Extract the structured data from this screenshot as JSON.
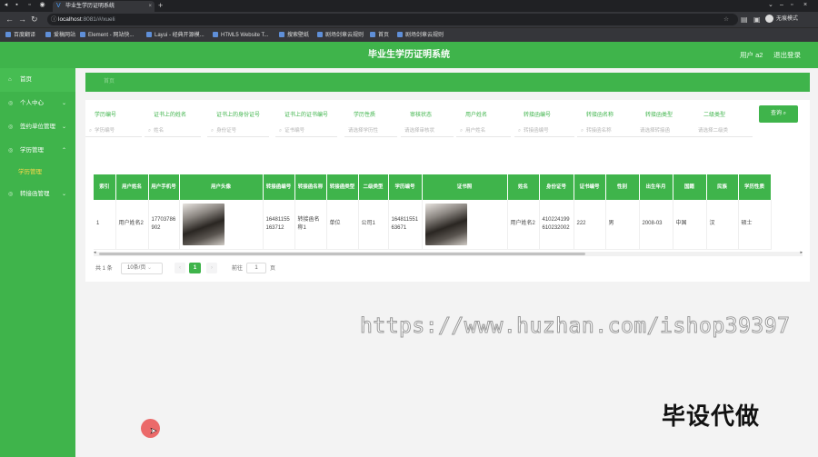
{
  "browser": {
    "tab_title": "毕业生学历证明系统",
    "url_host": "localhost",
    "url_rest": ":8081/#/xueli",
    "profile_label": "无痕模式",
    "bookmarks": [
      "百度翻译",
      "爱稿网站",
      "Element - 网站快...",
      "Layui - 经典开源模...",
      "HTML5 Website T...",
      "搜索壁纸",
      "剧场剑章云规则",
      "首页",
      "剧场剑章云规则"
    ]
  },
  "app": {
    "title": "毕业生学历证明系统",
    "user_label": "用户 a2",
    "logout_label": "退出登录"
  },
  "sidebar": {
    "items": [
      {
        "label": "首页",
        "icon": "home-icon",
        "has_arrow": false
      },
      {
        "label": "个人中心",
        "icon": "user-icon",
        "has_arrow": true
      },
      {
        "label": "签约单位管理",
        "icon": "building-icon",
        "has_arrow": true
      },
      {
        "label": "学历管理",
        "icon": "book-icon",
        "has_arrow": true
      }
    ],
    "sub_item": "学历管理",
    "last_item": {
      "label": "转接函管理",
      "icon": "file-icon"
    }
  },
  "breadcrumb": "首页",
  "filters": [
    {
      "label": "学历编号",
      "placeholder": "学历编号"
    },
    {
      "label": "证书上的姓名",
      "placeholder": "姓名"
    },
    {
      "label": "证书上的身份证号",
      "placeholder": "身份证号"
    },
    {
      "label": "证书上的证书编号",
      "placeholder": "证书编号"
    },
    {
      "label": "学历性质",
      "placeholder": "请选择学历性"
    },
    {
      "label": "审核状态",
      "placeholder": "请选择审核状"
    },
    {
      "label": "用户姓名",
      "placeholder": "用户姓名"
    },
    {
      "label": "转接函编号",
      "placeholder": "转接函编号"
    },
    {
      "label": "转接函名称",
      "placeholder": "转接函名称"
    },
    {
      "label": "转接函类型",
      "placeholder": "请选择转接函"
    },
    {
      "label": "二级类型",
      "placeholder": "请选择二级类"
    }
  ],
  "search_button": "查询",
  "table": {
    "headers": [
      "索引",
      "用户姓名",
      "用户手机号",
      "用户头像",
      "转接函编号",
      "转接函名称",
      "转接函类型",
      "二级类型",
      "学历编号",
      "证书照",
      "姓名",
      "身份证号",
      "证书编号",
      "性别",
      "出生年月",
      "国籍",
      "民族",
      "学历性质"
    ],
    "rows": [
      [
        "1",
        "用户姓名2",
        "17703786902",
        "",
        "16481155163712",
        "转接函名称1",
        "单位",
        "公司1",
        "16481155163671",
        "",
        "用户姓名2",
        "410224199610232002",
        "222",
        "男",
        "2008-03",
        "中国",
        "汉",
        "硕士"
      ]
    ]
  },
  "pager": {
    "total": "共 1 条",
    "page_size": "10条/页",
    "prev": "‹",
    "current": "1",
    "next": "›",
    "goto_label": "前往",
    "goto_value": "1",
    "page_suffix": "页"
  },
  "watermark": "https://www.huzhan.com/ishop39397",
  "stamp": "毕设代做",
  "colors": {
    "primary": "#3fb44b",
    "accent_text": "#ffd84a"
  }
}
